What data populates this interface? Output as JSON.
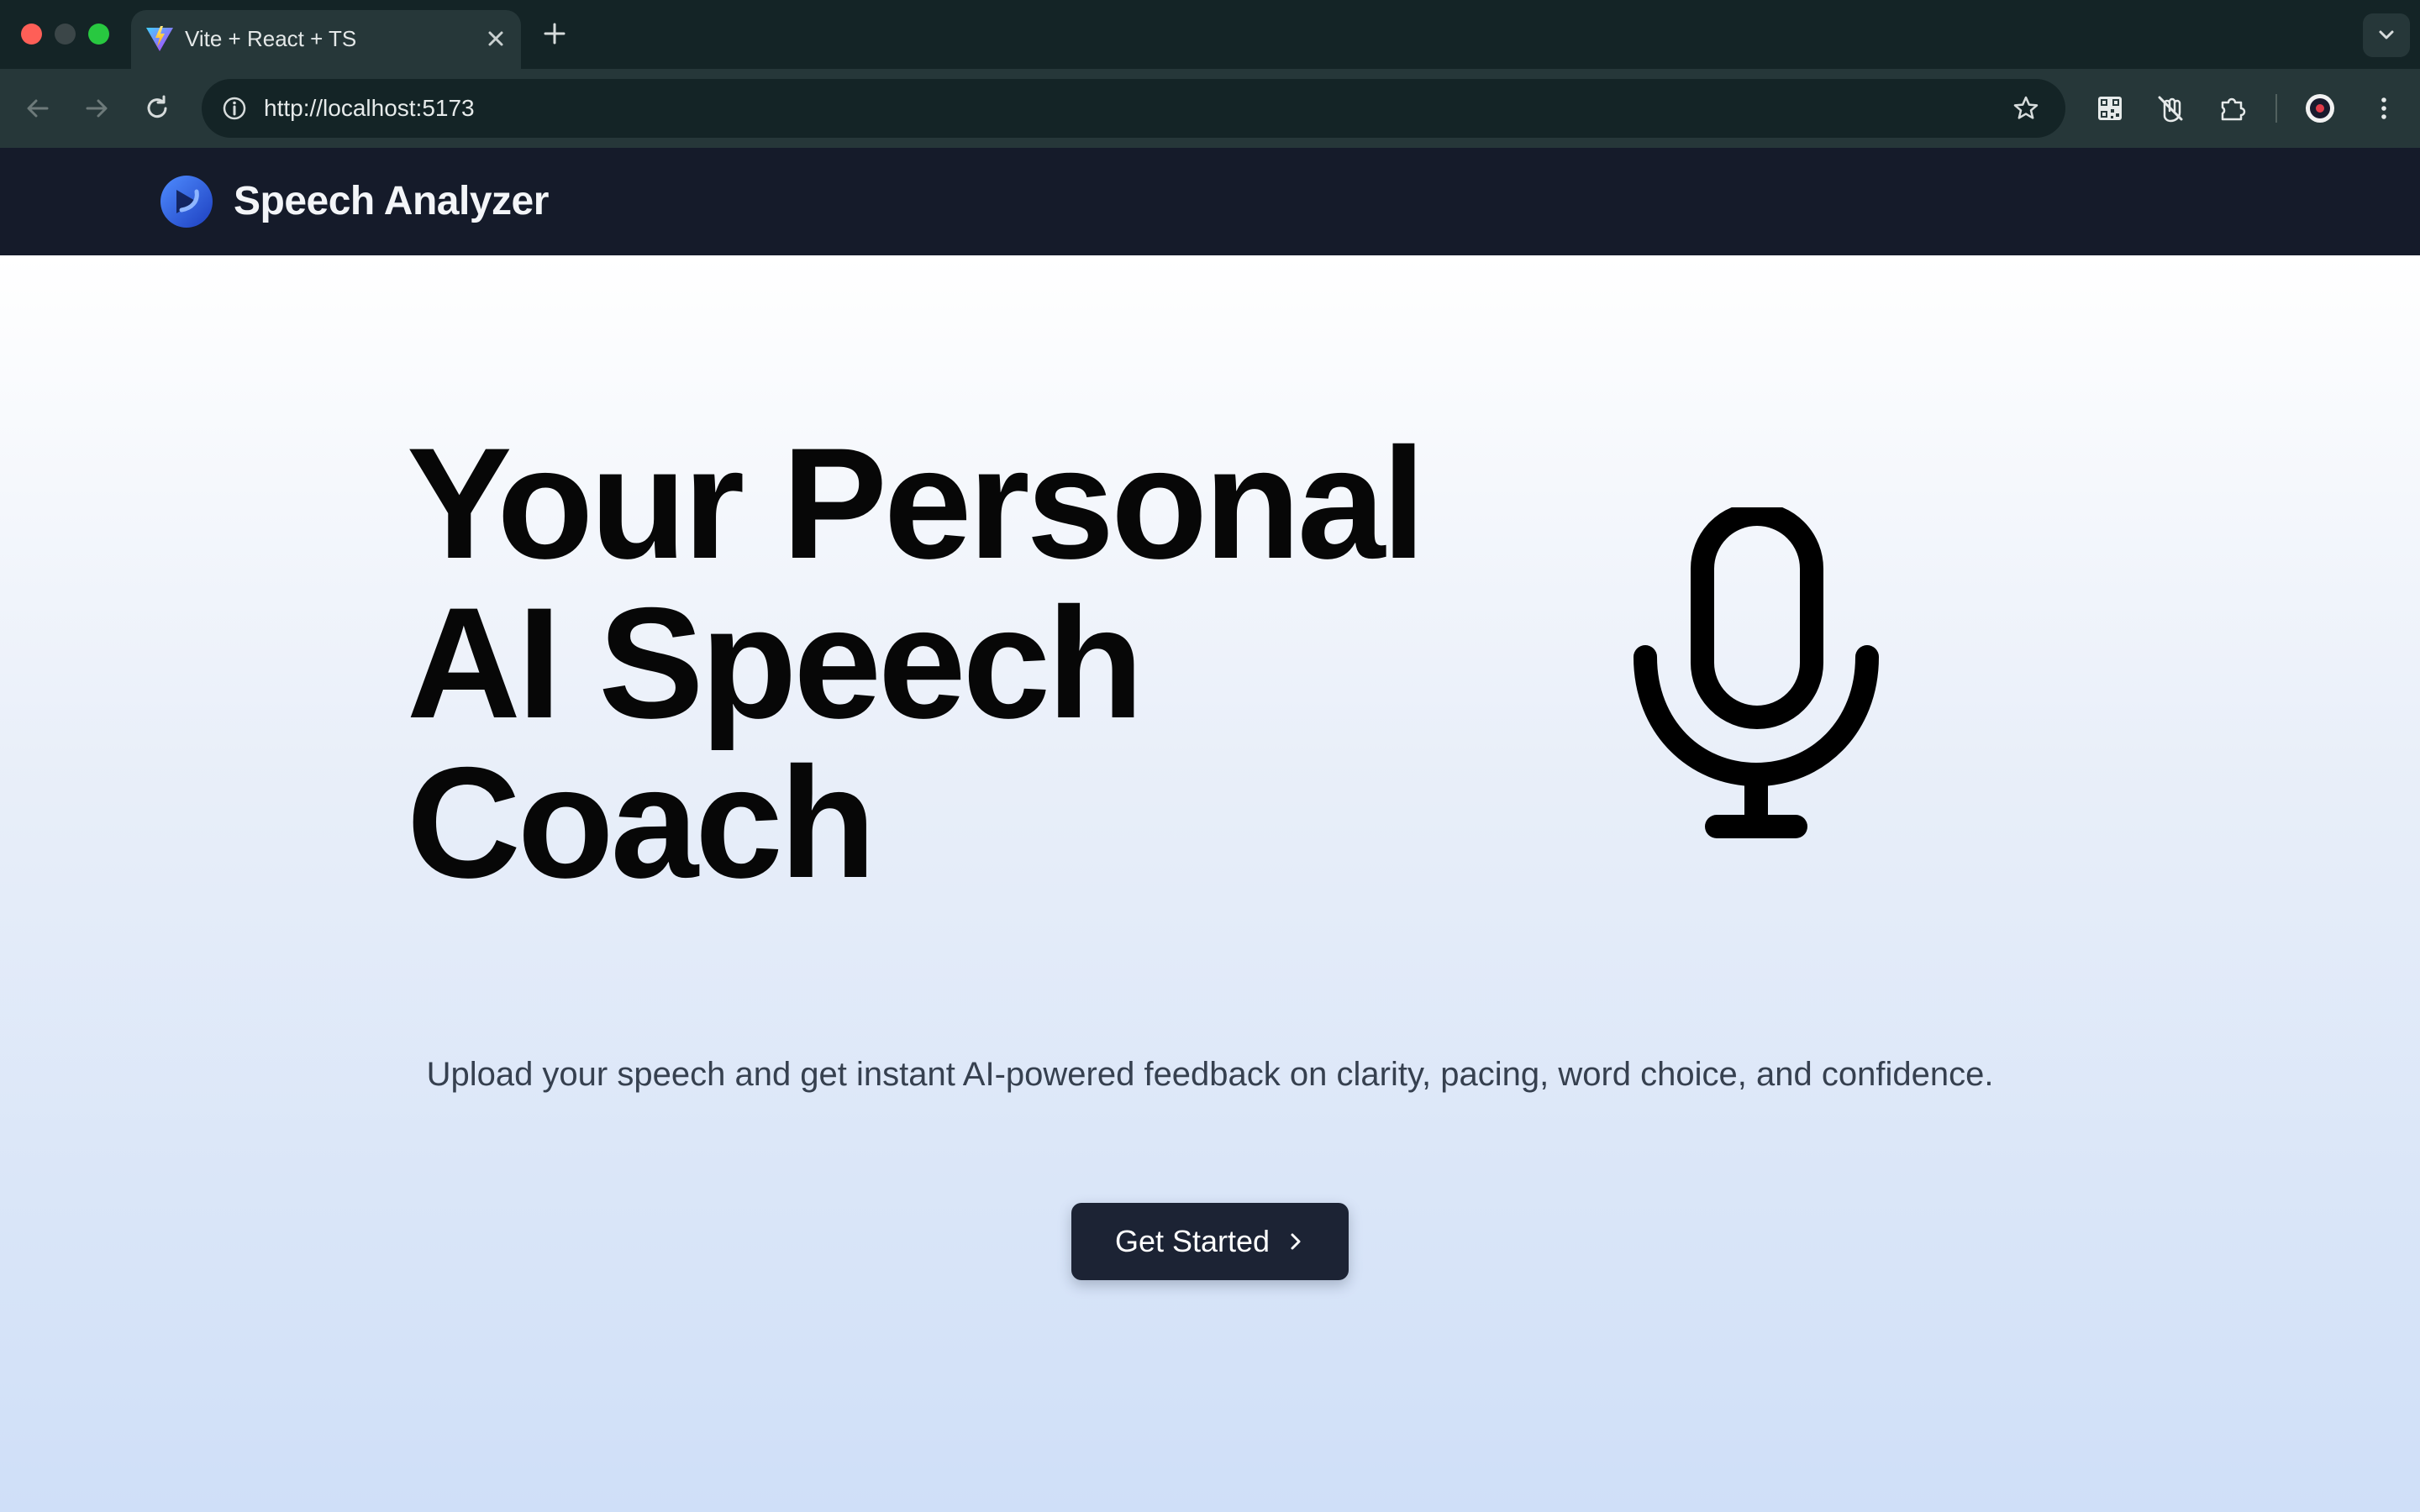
{
  "browser": {
    "tab": {
      "title": "Vite + React + TS",
      "favicon": "vite-logo-icon",
      "close_icon": "close-icon"
    },
    "new_tab_icon": "plus-icon",
    "tab_search_icon": "chevron-down-icon",
    "nav": {
      "back_icon": "arrow-left-icon",
      "forward_icon": "arrow-right-icon",
      "reload_icon": "reload-icon"
    },
    "address_bar": {
      "url": "http://localhost:5173",
      "site_info_icon": "info-icon",
      "bookmark_icon": "star-icon"
    },
    "extensions": [
      "qr-code-icon",
      "tracker-off-icon",
      "puzzle-icon"
    ],
    "profile_icon": "avatar-icon",
    "menu_icon": "kebab-menu-icon"
  },
  "app": {
    "name": "Speech Analyzer",
    "logo_icon": "speech-analyzer-logo-icon",
    "colors": {
      "header_bg": "#151b2a",
      "logo_blue": "#2f6df6",
      "button_bg": "#1c2334",
      "gradient_end": "#cfdff8"
    }
  },
  "hero": {
    "headline_lines": [
      "Your Personal",
      "AI Speech",
      "Coach"
    ],
    "illustration_icon": "microphone-icon",
    "subtitle": "Upload your speech and get instant AI-powered feedback on clarity, pacing, word choice, and confidence.",
    "cta": {
      "label": "Get Started",
      "icon": "chevron-right-icon"
    }
  }
}
